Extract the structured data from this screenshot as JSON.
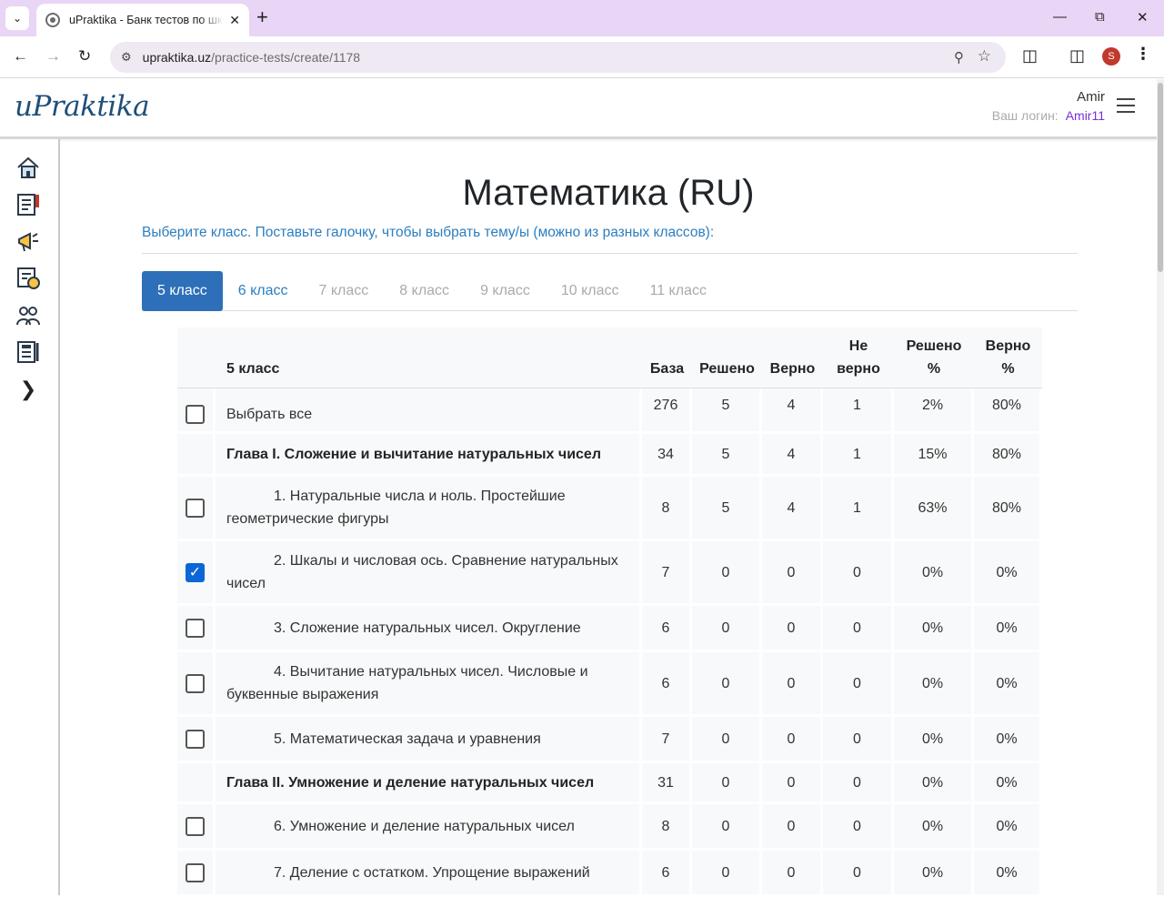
{
  "browser": {
    "tab_title": "uPraktika - Банк тестов по школьным предметам",
    "url_host": "upraktika.uz",
    "url_path": "/practice-tests/create/1178",
    "profile_initial": "S"
  },
  "header": {
    "logo": "uPraktika",
    "user_name": "Amir",
    "login_label": "Ваш логин:",
    "login_value": "Amir11"
  },
  "main": {
    "title": "Математика (RU)",
    "subtitle": "Выберите класс. Поставьте галочку, чтобы выбрать тему/ы (можно из разных классов):",
    "grade_tabs": [
      "5 класс",
      "6 класс",
      "7 класс",
      "8 класс",
      "9 класс",
      "10 класс",
      "11 класс"
    ]
  },
  "table": {
    "headers": {
      "grade": "5 класс",
      "base": "База",
      "solved": "Решено",
      "correct": "Верно",
      "incorrect_1": "Не",
      "incorrect_2": "верно",
      "solved_pct_1": "Решено",
      "solved_pct_2": "%",
      "correct_pct_1": "Верно",
      "correct_pct_2": "%"
    },
    "select_all": {
      "label": "Выбрать все",
      "base": "276",
      "solved": "5",
      "correct": "4",
      "incorrect": "1",
      "solved_pct": "2%",
      "correct_pct": "80%"
    },
    "rows": [
      {
        "kind": "chapter",
        "name": "Глава I. Сложение и вычитание натуральных чисел",
        "base": "34",
        "solved": "5",
        "correct": "4",
        "incorrect": "1",
        "solved_pct": "15%",
        "correct_pct": "80%"
      },
      {
        "kind": "topic",
        "checked": false,
        "name": "1. Натуральные числа и ноль. Простейшие геометрические фигуры",
        "base": "8",
        "solved": "5",
        "correct": "4",
        "incorrect": "1",
        "solved_pct": "63%",
        "correct_pct": "80%"
      },
      {
        "kind": "topic",
        "checked": true,
        "name": "2. Шкалы и числовая ось. Сравнение натуральных чисел",
        "base": "7",
        "solved": "0",
        "correct": "0",
        "incorrect": "0",
        "solved_pct": "0%",
        "correct_pct": "0%"
      },
      {
        "kind": "topic",
        "checked": false,
        "name": "3. Сложение натуральных чисел. Округление",
        "base": "6",
        "solved": "0",
        "correct": "0",
        "incorrect": "0",
        "solved_pct": "0%",
        "correct_pct": "0%"
      },
      {
        "kind": "topic",
        "checked": false,
        "name": "4. Вычитание натуральных чисел. Числовые и буквенные выражения",
        "base": "6",
        "solved": "0",
        "correct": "0",
        "incorrect": "0",
        "solved_pct": "0%",
        "correct_pct": "0%"
      },
      {
        "kind": "topic",
        "checked": false,
        "name": "5. Математическая задача и уравнения",
        "base": "7",
        "solved": "0",
        "correct": "0",
        "incorrect": "0",
        "solved_pct": "0%",
        "correct_pct": "0%"
      },
      {
        "kind": "chapter",
        "name": "Глава II. Умножение и деление натуральных чисел",
        "base": "31",
        "solved": "0",
        "correct": "0",
        "incorrect": "0",
        "solved_pct": "0%",
        "correct_pct": "0%"
      },
      {
        "kind": "topic",
        "checked": false,
        "name": "6. Умножение и деление натуральных чисел",
        "base": "8",
        "solved": "0",
        "correct": "0",
        "incorrect": "0",
        "solved_pct": "0%",
        "correct_pct": "0%"
      },
      {
        "kind": "topic",
        "checked": false,
        "name": "7. Деление с остатком. Упрощение выражений",
        "base": "6",
        "solved": "0",
        "correct": "0",
        "incorrect": "0",
        "solved_pct": "0%",
        "correct_pct": "0%"
      }
    ]
  },
  "colors": {
    "accent": "#2d6fb8",
    "link": "#2b7ec0",
    "login": "#7a2fd3",
    "logo": "#1e4f78",
    "checkbox_checked": "#0b66d6"
  },
  "icons": {
    "sidebar": [
      "home-icon",
      "test-icon",
      "megaphone-icon",
      "certificate-icon",
      "users-icon",
      "exam-icon",
      "chevron-right-icon"
    ]
  }
}
